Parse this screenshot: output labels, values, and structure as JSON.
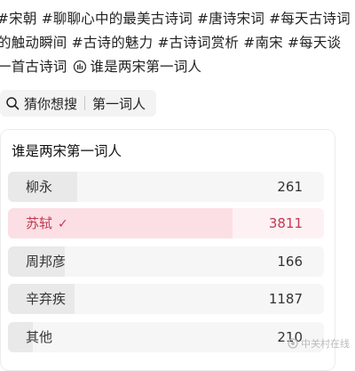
{
  "hashtags": {
    "line1": "#宋朝 #聊聊心中的最美古诗词 #唐诗宋词 #每天古诗词",
    "line2": "的触动瞬间 #古诗的魅力 #古诗词赏析 #南宋 #每天谈",
    "line3_tag": "一首古诗词",
    "line3_link": "谁是两宋第一词人"
  },
  "search_chip": {
    "label": "猜你想搜",
    "query": "第一词人"
  },
  "poll": {
    "title": "谁是两宋第一词人",
    "options": [
      {
        "label": "柳永",
        "count": "261",
        "share": 0.22,
        "selected": false
      },
      {
        "label": "苏轼",
        "count": "3811",
        "share": 0.71,
        "selected": true
      },
      {
        "label": "周邦彦",
        "count": "166",
        "share": 0.18,
        "selected": false
      },
      {
        "label": "辛弃疾",
        "count": "1187",
        "share": 0.21,
        "selected": false
      },
      {
        "label": "其他",
        "count": "210",
        "share": 0.08,
        "selected": false
      }
    ],
    "check_mark": "✓",
    "accent_color": "#c23a52"
  },
  "watermark": {
    "text": "中关村在线"
  },
  "icons": [
    "poll-icon",
    "search-icon",
    "check-icon",
    "watermark-logo-icon"
  ]
}
